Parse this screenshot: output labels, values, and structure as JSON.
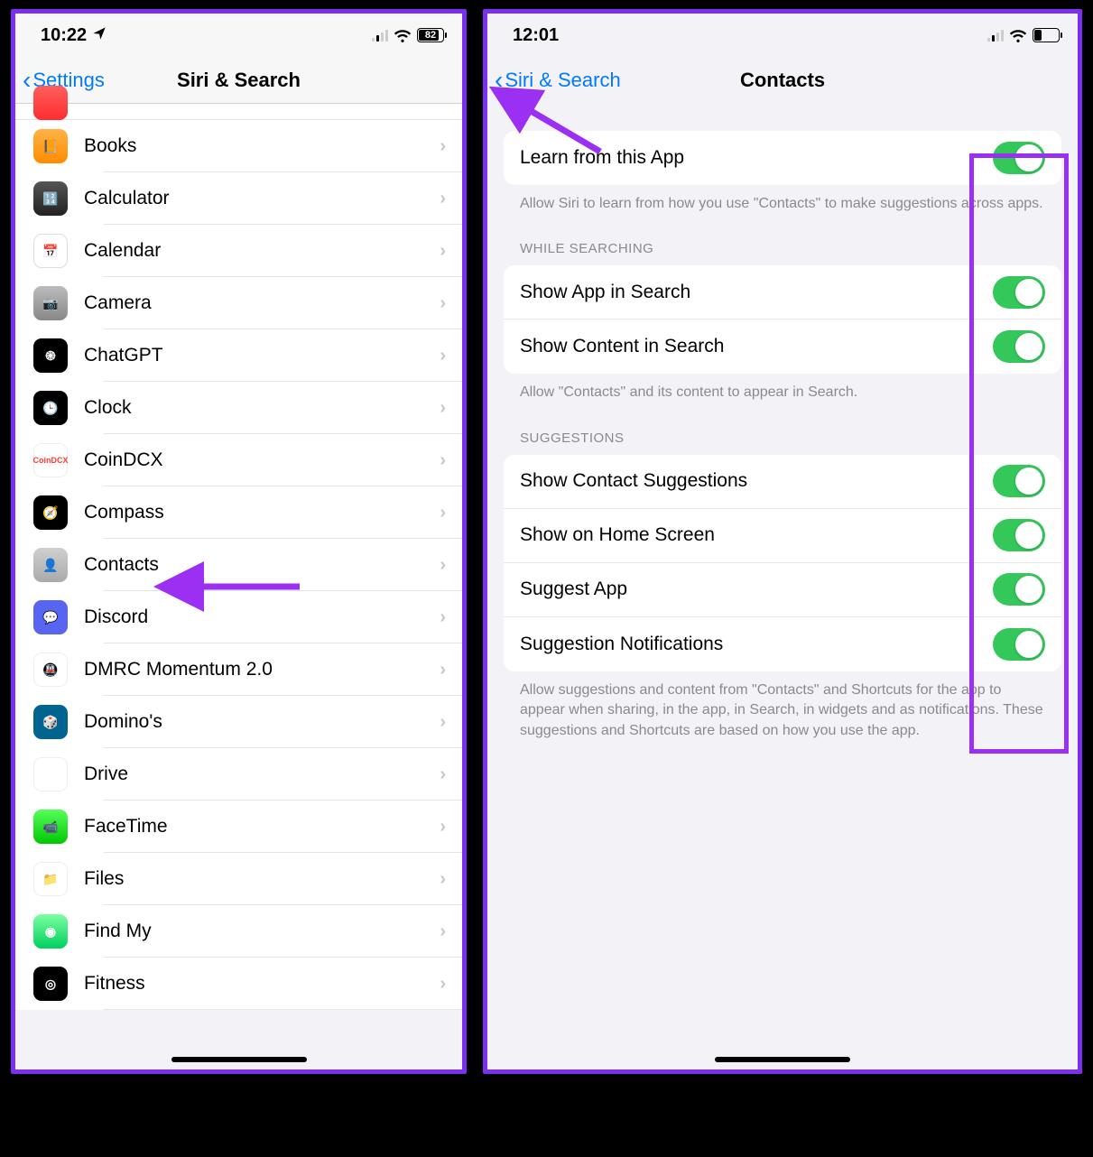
{
  "left": {
    "status": {
      "time": "10:22",
      "battery": "82"
    },
    "nav": {
      "back": "Settings",
      "title": "Siri & Search"
    },
    "apps": [
      {
        "name": "Books",
        "iconClass": "i-orange",
        "glyph": "📙"
      },
      {
        "name": "Calculator",
        "iconClass": "i-gray",
        "glyph": "🔢"
      },
      {
        "name": "Calendar",
        "iconClass": "i-white",
        "glyph": "📅"
      },
      {
        "name": "Camera",
        "iconClass": "i-cam",
        "glyph": "📷"
      },
      {
        "name": "ChatGPT",
        "iconClass": "i-black",
        "glyph": "֎"
      },
      {
        "name": "Clock",
        "iconClass": "i-clock",
        "glyph": "🕒"
      },
      {
        "name": "CoinDCX",
        "iconClass": "i-coin",
        "glyph": "CoinDCX"
      },
      {
        "name": "Compass",
        "iconClass": "i-compass",
        "glyph": "🧭"
      },
      {
        "name": "Contacts",
        "iconClass": "i-contacts",
        "glyph": "👤"
      },
      {
        "name": "Discord",
        "iconClass": "i-discord",
        "glyph": "💬"
      },
      {
        "name": "DMRC Momentum 2.0",
        "iconClass": "i-dmrc",
        "glyph": "🚇"
      },
      {
        "name": "Domino's",
        "iconClass": "i-dominos",
        "glyph": "🎲"
      },
      {
        "name": "Drive",
        "iconClass": "i-drive",
        "glyph": "▲"
      },
      {
        "name": "FaceTime",
        "iconClass": "i-facetime",
        "glyph": "📹"
      },
      {
        "name": "Files",
        "iconClass": "i-files",
        "glyph": "📁"
      },
      {
        "name": "Find My",
        "iconClass": "i-findmy",
        "glyph": "◉"
      },
      {
        "name": "Fitness",
        "iconClass": "i-fitness",
        "glyph": "◎"
      }
    ]
  },
  "right": {
    "status": {
      "time": "12:01"
    },
    "nav": {
      "back": "Siri & Search",
      "title": "Contacts"
    },
    "group1": {
      "rows": [
        {
          "label": "Learn from this App",
          "on": true
        }
      ],
      "footer": "Allow Siri to learn from how you use \"Contacts\" to make suggestions across apps."
    },
    "group2": {
      "header": "WHILE SEARCHING",
      "rows": [
        {
          "label": "Show App in Search",
          "on": true
        },
        {
          "label": "Show Content in Search",
          "on": true
        }
      ],
      "footer": "Allow \"Contacts\" and its content to appear in Search."
    },
    "group3": {
      "header": "SUGGESTIONS",
      "rows": [
        {
          "label": "Show Contact Suggestions",
          "on": true
        },
        {
          "label": "Show on Home Screen",
          "on": true
        },
        {
          "label": "Suggest App",
          "on": true
        },
        {
          "label": "Suggestion Notifications",
          "on": true
        }
      ],
      "footer": "Allow suggestions and content from \"Contacts\" and Shortcuts for the app to appear when sharing, in the app, in Search, in widgets and as notifications. These suggestions and Shortcuts are based on how you use the app."
    }
  }
}
